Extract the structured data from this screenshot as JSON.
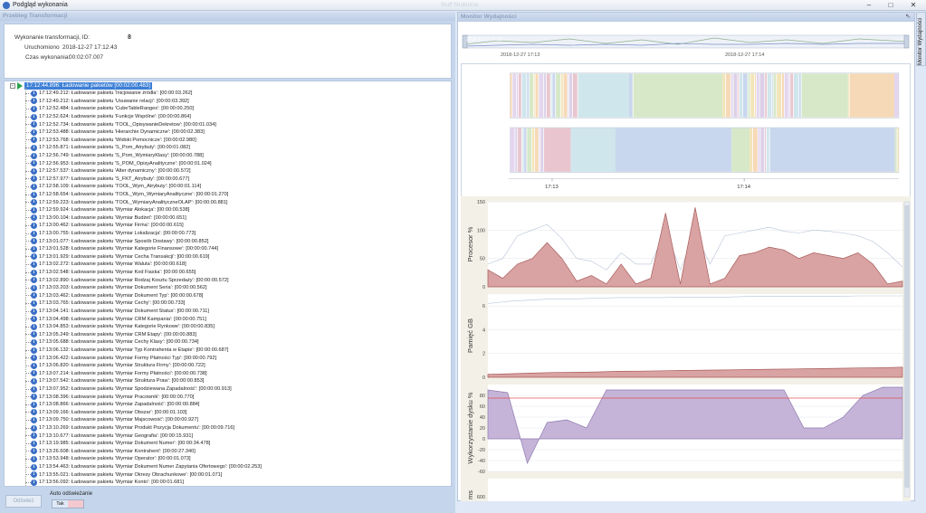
{
  "window": {
    "title": "Podgląd wykonania",
    "ghost_title": "Stuff Strukturza"
  },
  "left_panel": {
    "header": "Przebieg Transformacji",
    "info": {
      "id_label": "Wykonanie transformacji, ID:",
      "id_value": "8",
      "started_label": "Uruchomiono",
      "started_value": "2018-12-27 17:12:43",
      "duration_label": "Czas wykonania:",
      "duration_value": "00:02:07.007"
    },
    "tree": {
      "root": "17:12:44.896: Ładowanie pakietów [00:02:00.483]",
      "items": [
        "17:12:49.212: Ładowanie pakietu 'Inicjowanie źródła': [00:00:03.262]",
        "17:12:49.212: Ładowanie pakietu 'Usuwanie relacji': [00:00:03.392]",
        "17:12:52.484: Ładowanie pakietu 'CubeTableRanges': [00:00:00.250]",
        "17:12:52.624: Ładowanie pakietu 'Funkcje Wspólne': [00:00:00.864]",
        "17:12:52.734: Ładowanie pakietu 'TOOL_OpisywanieDekretow': [00:00:01.034]",
        "17:12:53.488: Ładowanie pakietu 'Hierarchie Dynamiczne': [00:00:02.383]",
        "17:12:53.768: Ładowanie pakietu 'Widoki Pomocnicze': [00:00:02.980]",
        "17:12:55.871: Ładowanie pakietu 'S_Pom_Atrybuty': [00:00:01.082]",
        "17:12:56.749: Ładowanie pakietu 'S_Pom_WymiaryKlasy': [00:00:00.788]",
        "17:12:56.953: Ładowanie pakietu 'S_POM_OpisyAnalityczne': [00:00:01.024]",
        "17:12:57.537: Ładowanie pakietu 'Alter dynamiczny': [00:00:00.572]",
        "17:12:57.977: Ładowanie pakietu 'S_FKT_Atrybuty': [00:00:00.677]",
        "17:12:58.109: Ładowanie pakietu 'TOOL_Wym_Atrybuty': [00:00:01.114]",
        "17:12:58.654: Ładowanie pakietu 'TOOL_Wym_WymiaryAnalityczne': [00:00:01.270]",
        "17:12:59.223: Ładowanie pakietu 'TOOL_WymiaryAnalityczneOLAP': [00:00:00.881]",
        "17:12:59.924: Ładowanie pakietu 'Wymiar Alokacja': [00:00:00.538]",
        "17:13:00.104: Ładowanie pakietu 'Wymiar Budżet': [00:00:00.651]",
        "17:13:00.462: Ładowanie pakietu 'Wymiar Firma': [00:00:00.615]",
        "17:13:00.755: Ładowanie pakietu 'Wymiar Lokalizacja': [00:00:00.773]",
        "17:13:01.077: Ładowanie pakietu 'Wymiar Sposób Dostawy': [00:00:00.852]",
        "17:13:01.528: Ładowanie pakietu 'Wymiar Kategorie Finansowe': [00:00:00.744]",
        "17:13:01.929: Ładowanie pakietu 'Wymiar Cecha Transakcji': [00:00:00.619]",
        "17:13:02.272: Ładowanie pakietu 'Wymiar Waluta': [00:00:00.618]",
        "17:13:02.548: Ładowanie pakietu 'Wymiar Kod Fiaska': [00:00:00.655]",
        "17:13:02.890: Ładowanie pakietu 'Wymiar Rodzaj Kosztu Sprzedaży': [00:00:00.572]",
        "17:13:03.203: Ładowanie pakietu 'Wymiar Dokument Seria': [00:00:00.562]",
        "17:13:03.462: Ładowanie pakietu 'Wymiar Dokument Typ': [00:00:00.678]",
        "17:13:03.765: Ładowanie pakietu 'Wymiar Cechy': [00:00:00.733]",
        "17:13:04.141: Ładowanie pakietu 'Wymiar Dokument Status': [00:00:00.711]",
        "17:13:04.498: Ładowanie pakietu 'Wymiar CRM Kampania': [00:00:00.751]",
        "17:13:04.853: Ładowanie pakietu 'Wymiar Kategorie Rynkowe': [00:00:00.835]",
        "17:13:05.249: Ładowanie pakietu 'Wymiar CRM Etapy': [00:00:00.883]",
        "17:13:05.688: Ładowanie pakietu 'Wymiar Cechy Klasy': [00:00:00.734]",
        "17:13:06.132: Ładowanie pakietu 'Wymiar Typ Kontrahenta w Etapie': [00:00:00.687]",
        "17:13:06.422: Ładowanie pakietu 'Wymiar Formy Płatności Typ': [00:00:00.792]",
        "17:13:06.820: Ładowanie pakietu 'Wymiar Struktura Firmy': [00:00:00.722]",
        "17:13:07.214: Ładowanie pakietu 'Wymiar Formy Płatności': [00:00:00.738]",
        "17:13:07.542: Ładowanie pakietu 'Wymiar Struktura Praw': [00:00:00.853]",
        "17:13:07.952: Ładowanie pakietu 'Wymiar Spodziewana Zapadalność': [00:00:00.913]",
        "17:13:08.396: Ładowanie pakietu 'Wymiar Pracownik': [00:00:00.770]",
        "17:13:08.866: Ładowanie pakietu 'Wymiar Zapadalność': [00:00:00.884]",
        "17:13:09.166: Ładowanie pakietu 'Wymiar Obszar': [00:00:01.103]",
        "17:13:09.750: Ładowanie pakietu 'Wymiar Majscowość': [00:00:00.927]",
        "17:13:10.269: Ładowanie pakietu 'Wymiar Produkt Pozycja Dokumentu': [00:00:09.716]",
        "17:13:10.677: Ładowanie pakietu 'Wymiar Geografia': [00:00:15.931]",
        "17:13:19.985: Ładowanie pakietu 'Wymiar Dokument Numer': [00:00:34.478]",
        "17:13:26.608: Ładowanie pakietu 'Wymiar Kontrahent': [00:00:27.340]",
        "17:13:53.948: Ładowanie pakietu 'Wymiar Operator': [00:00:01.073]",
        "17:13:54.463: Ładowanie pakietu 'Wymiar Dokument Numer Zapytania Ofertowego': [00:00:02.253]",
        "17:13:55.021: Ładowanie pakietu 'Wymiar Okresy Obrachunkowe': [00:00:01.071]",
        "17:13:56.092: Ładowanie pakietu 'Wymiar Konto': [00:00:01.681]",
        "17:13:56.217: Ładowanie pakietu 'Wymiar Magazyn': [00:00:01.427]"
      ]
    },
    "refresh_button": "Odśwież",
    "auto_refresh_label": "Auto odświeżanie",
    "toggle_on": "Tak"
  },
  "right_panel": {
    "header": "Monitor Wydajności",
    "side_tab": "Monitor Wydajności",
    "overview_labels": [
      "2018-12-27 17:13",
      "2018-12-27 17:14"
    ],
    "timeline_ticks": [
      "17:13",
      "17:14"
    ],
    "colors": {
      "cpu": "#d9a3a3",
      "memory": "#d9a3a3",
      "disk": "#c6b4d8",
      "threshold": "#e05050"
    }
  },
  "chart_data": [
    {
      "type": "area",
      "ylabel": "Procesor %",
      "ylim": [
        0,
        150
      ],
      "yticks": [
        0,
        50,
        100,
        150
      ],
      "series": [
        {
          "values": [
            30,
            15,
            40,
            50,
            78,
            50,
            10,
            20,
            5,
            40,
            5,
            15,
            130,
            5,
            140,
            5,
            15,
            55,
            60,
            70,
            65,
            50,
            60,
            55,
            50,
            60,
            40,
            5,
            10
          ]
        },
        {
          "values": [
            40,
            50,
            90,
            100,
            110,
            85,
            50,
            45,
            30,
            60,
            40,
            40,
            100,
            30,
            95,
            40,
            90,
            95,
            100,
            105,
            98,
            95,
            100,
            98,
            95,
            90,
            80,
            60,
            35
          ]
        }
      ]
    },
    {
      "type": "area",
      "ylabel": "Pamięć GB",
      "ylim": [
        0,
        7
      ],
      "yticks": [
        0,
        2,
        4,
        6
      ],
      "series": [
        {
          "values": [
            0.25,
            0.3,
            0.35,
            0.4,
            0.42,
            0.45,
            0.5,
            0.52,
            0.55,
            0.58,
            0.6,
            0.62,
            0.65,
            0.68,
            0.7,
            0.72,
            0.75,
            0.78,
            0.8,
            0.85
          ]
        },
        {
          "values": [
            6.2,
            6.4,
            6.5,
            6.6,
            6.6,
            6.65,
            6.7,
            6.7,
            6.7,
            6.75,
            6.75,
            6.75,
            6.8,
            6.8,
            6.8,
            6.8,
            6.8,
            6.85,
            6.85,
            6.85
          ]
        }
      ]
    },
    {
      "type": "area",
      "ylabel": "Wykorzystanie dysku %",
      "ylim": [
        -60,
        100
      ],
      "yticks": [
        -60,
        -40,
        -20,
        0,
        20,
        40,
        60,
        80
      ],
      "threshold": 75,
      "series": [
        {
          "values": [
            90,
            85,
            -45,
            30,
            35,
            20,
            90,
            90,
            90,
            90,
            90,
            90,
            90,
            90,
            90,
            90,
            20,
            20,
            40,
            80,
            95,
            95
          ]
        }
      ]
    },
    {
      "type": "line",
      "ylabel": "ms",
      "yticks": [
        600
      ]
    }
  ]
}
